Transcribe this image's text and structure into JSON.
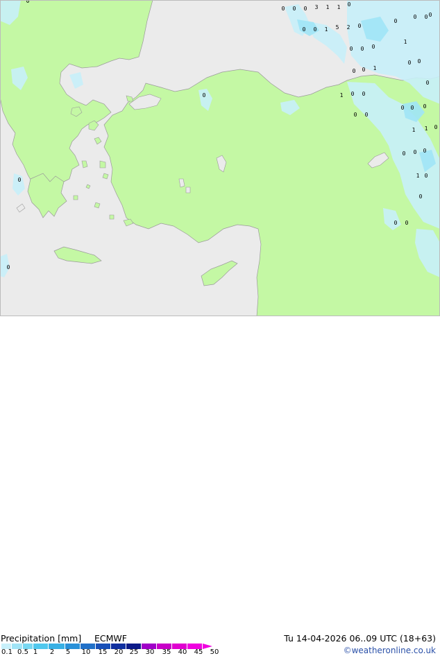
{
  "footer": {
    "title": "Precipitation [mm]",
    "model": "ECMWF",
    "valid": "Tu 14-04-2026 06..09 UTC (18+63)",
    "credit": "©weatheronline.co.uk"
  },
  "legend": {
    "labels": [
      "0.1",
      "0.5",
      "1",
      "2",
      "5",
      "10",
      "15",
      "20",
      "25",
      "30",
      "35",
      "40",
      "45",
      "50"
    ],
    "colors": [
      "#c8f0fa",
      "#a0e4f6",
      "#78d8f2",
      "#50c8ee",
      "#38b0e4",
      "#2890d8",
      "#2070c8",
      "#1850b8",
      "#1030a0",
      "#0c1a88",
      "#a000c8",
      "#c800c8",
      "#e000d0",
      "#f000e0"
    ]
  },
  "map": {
    "land_color": "#c4f8a4",
    "sea_color": "#ebebeb",
    "precip_color": "#c8f0fa",
    "precip_color_strong": "#a0e4f6",
    "values": [
      "0",
      "0",
      "0",
      "3",
      "1",
      "1",
      "0",
      "0",
      "0",
      "1",
      "5",
      "2",
      "0",
      "0",
      "0",
      "0",
      "1",
      "0",
      "0",
      "0",
      "0",
      "0",
      "1",
      "0",
      "0",
      "1",
      "0",
      "0",
      "0",
      "0",
      "0",
      "0",
      "0",
      "1",
      "1",
      "0",
      "0",
      "0",
      "0",
      "1",
      "0",
      "0",
      "0",
      "0",
      "0",
      "0",
      "0",
      "0",
      "0",
      "0"
    ]
  }
}
